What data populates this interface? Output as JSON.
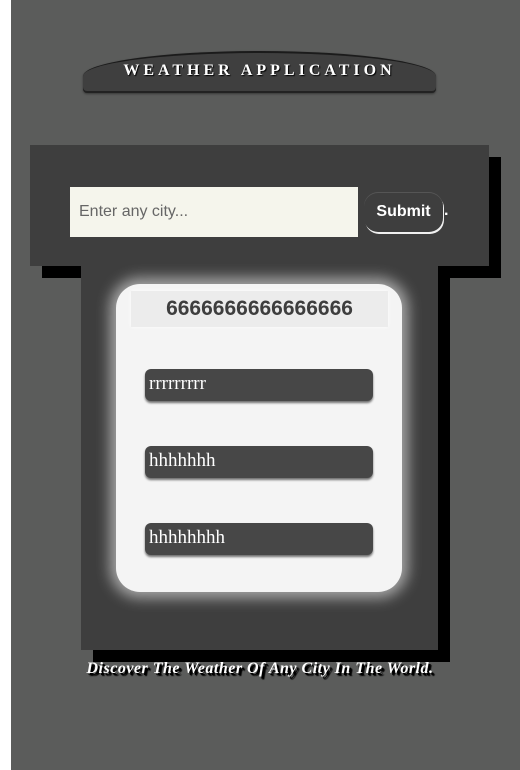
{
  "header": {
    "title": "WEATHER APPLICATION"
  },
  "search": {
    "placeholder": "Enter any city...",
    "value": "",
    "submit_label": "Submit",
    "trailing_text": "."
  },
  "result": {
    "heading": "6666666666666666",
    "fields": [
      "rrrrrrrrr",
      "hhhhhhh",
      "hhhhhhhh"
    ]
  },
  "footer": {
    "tagline": "Discover The Weather Of Any City In The World."
  },
  "colors": {
    "background": "#5b5c5b",
    "panel": "#3e3e3e",
    "card": "#f4f4f4",
    "input_bg": "#f5f5ec"
  }
}
